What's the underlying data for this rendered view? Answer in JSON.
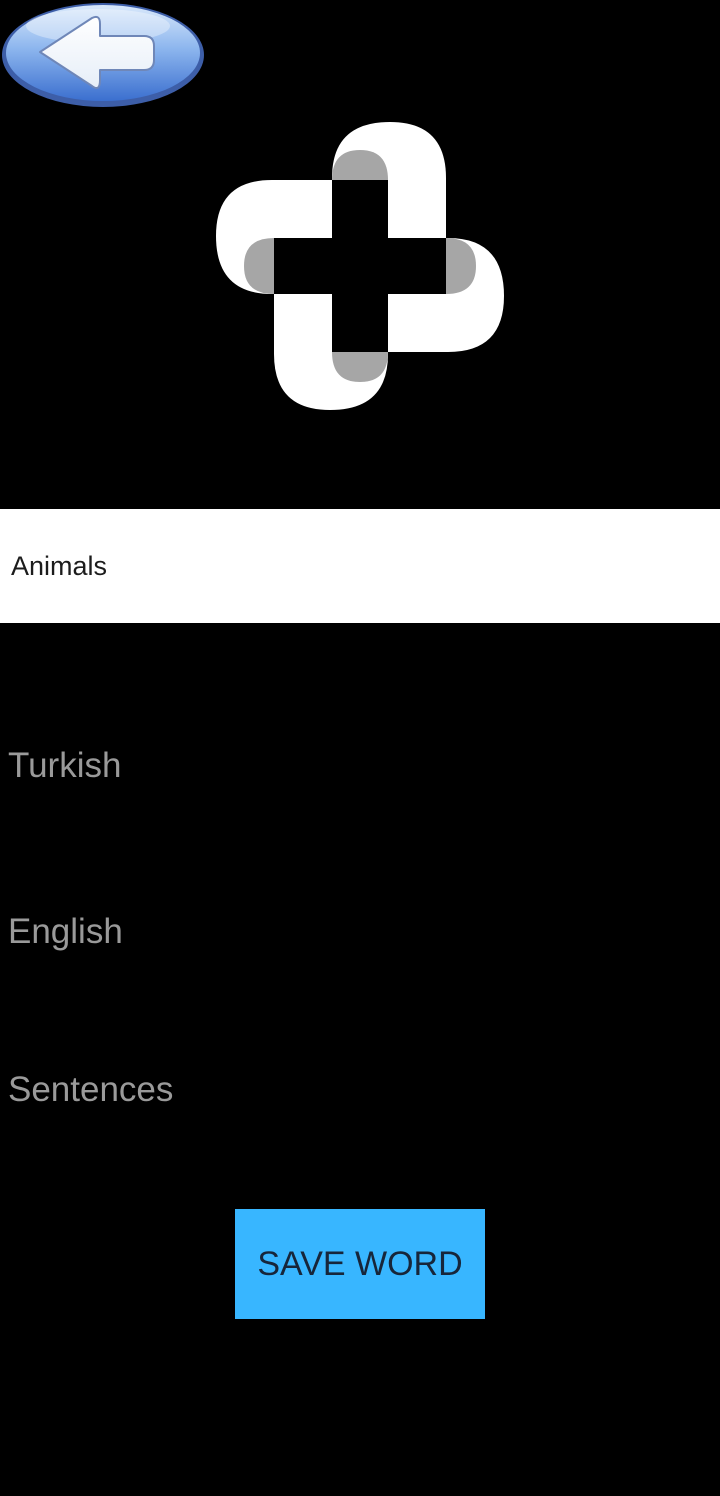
{
  "header": {
    "back_icon": "arrow-left-icon"
  },
  "image_picker": {
    "icon": "add-plus-icon"
  },
  "category": {
    "value": "Animals"
  },
  "fields": {
    "turkish_placeholder": "Turkish",
    "english_placeholder": "English",
    "sentences_placeholder": "Sentences"
  },
  "actions": {
    "save_label": "SAVE WORD"
  },
  "colors": {
    "background": "#000000",
    "button": "#38b6ff",
    "button_text": "#17263a",
    "placeholder": "#9a9a9a",
    "back_button_blue": "#4f86d9"
  }
}
